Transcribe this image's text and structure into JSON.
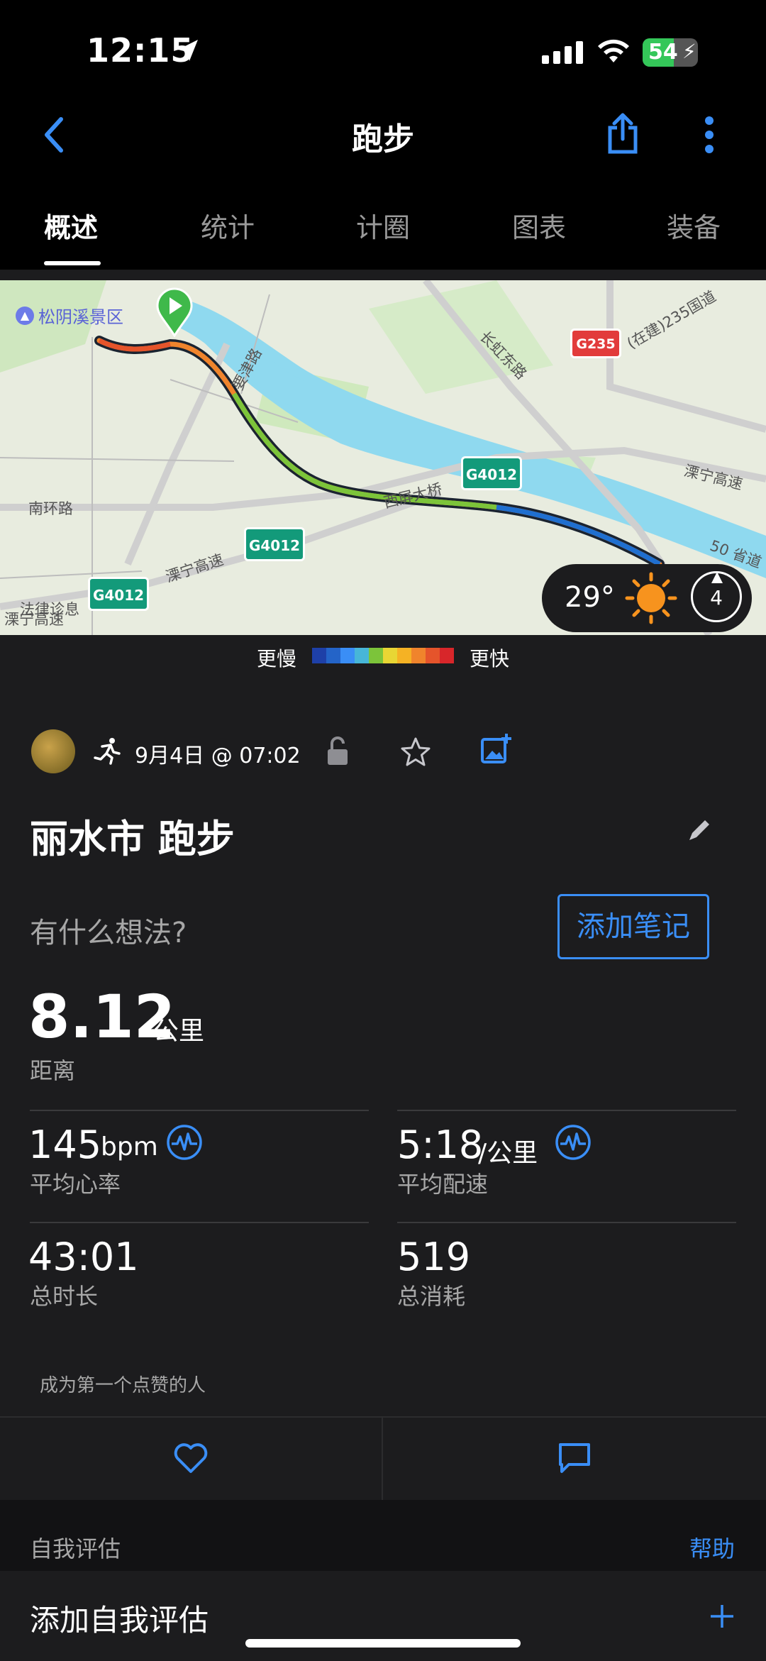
{
  "status_bar": {
    "time": "12:15",
    "battery": "54"
  },
  "header": {
    "title": "跑步"
  },
  "tabs": [
    {
      "label": "概述",
      "active": true
    },
    {
      "label": "统计"
    },
    {
      "label": "计圈"
    },
    {
      "label": "图表"
    },
    {
      "label": "装备"
    }
  ],
  "map": {
    "labels": {
      "park": "松阴溪景区",
      "road_left": "南环路",
      "road_xiping": "西屏大桥",
      "road_changhong": "长虹东路",
      "road_g235_text": "(在建)235国道",
      "road_liningtop": "溧宁高速",
      "road_lining_right": "溧宁高速",
      "road_lining_bottom": "溧宁高速",
      "road_50": "50 省道",
      "road_yaojin": "要津路",
      "road_bottomleft": "溧宁高速",
      "road_bottomleft2": "法律诊息"
    },
    "badges": {
      "g4012": "G4012",
      "g235": "G235"
    },
    "weather": {
      "temp": "29°",
      "wind": "4"
    }
  },
  "legend": {
    "slower": "更慢",
    "faster": "更快"
  },
  "activity": {
    "date": "9月4日 @ 07:02",
    "name": "丽水市 跑步",
    "thoughts_placeholder": "有什么想法?",
    "add_note": "添加笔记",
    "distance": {
      "value": "8.12",
      "unit": "公里",
      "label": "距离"
    },
    "heart_rate": {
      "value": "145",
      "unit": "bpm",
      "label": "平均心率"
    },
    "pace": {
      "value": "5:18",
      "unit": "/公里",
      "label": "平均配速"
    },
    "duration": {
      "value": "43:01",
      "label": "总时长"
    },
    "calories": {
      "value": "519",
      "label": "总消耗"
    },
    "likes": "成为第一个点赞的人"
  },
  "self_eval": {
    "title": "自我评估",
    "help": "帮助",
    "add": "添加自我评估"
  },
  "colors": {
    "accent": "#3a8ef6",
    "background": "#1c1c1e"
  }
}
